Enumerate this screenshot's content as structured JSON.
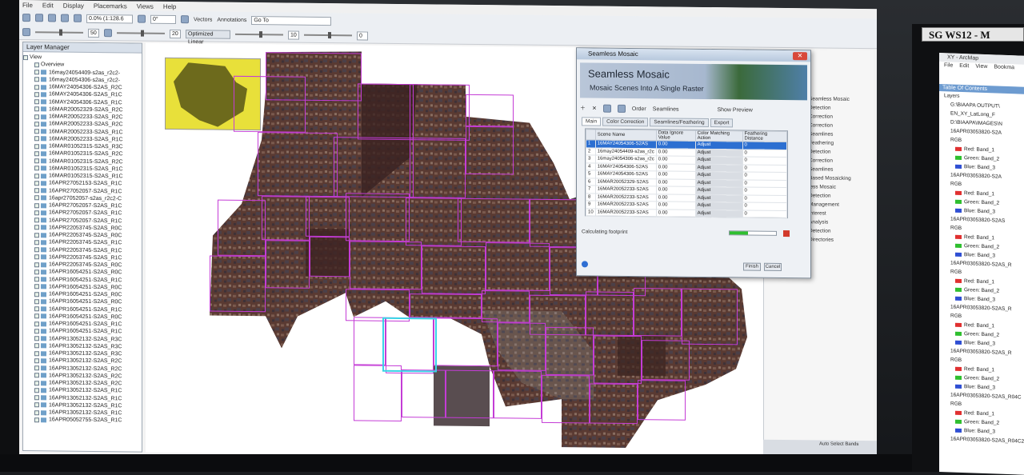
{
  "app": {
    "menus": [
      "File",
      "Edit",
      "Display",
      "Placemarks",
      "Views",
      "Help"
    ],
    "zoom_value": "0.0% (1:128.6",
    "angle_value": "0°",
    "field_50": "50",
    "field_20": "20",
    "field_10": "10",
    "field_0": "0",
    "stretch_label": "Optimized Linear",
    "vectors_label": "Vectors",
    "annotations_label": "Annotations",
    "goto_label": "Go To"
  },
  "layer_manager": {
    "title": "Layer Manager",
    "view_label": "View",
    "overview_label": "Overview",
    "layers": [
      "16may24054409-s2as_r2c2-",
      "16may24054306-s2as_r2c2-",
      "16MAY24054306-S2AS_R2C",
      "16MAY24054306-S2AS_R1C",
      "16MAY24054306-S2AS_R1C",
      "16MAR20052329-S2AS_R2C",
      "16MAR20052233-S2AS_R2C",
      "16MAR20052233-S2AS_R2C",
      "16MAR20052233-S2AS_R1C",
      "16MAR20052233-S2AS_R1C",
      "16MAR01052315-S2AS_R3C",
      "16MAR01052315-S2AS_R2C",
      "16MAR01052315-S2AS_R2C",
      "16MAR01052315-S2AS_R1C",
      "16MAR01052315-S2AS_R1C",
      "16APR27052153-S2AS_R1C",
      "16APR27052057-S2AS_R1C",
      "16apr27052057-s2as_r2c2-C",
      "16APR27052057-S2AS_R1C",
      "16APR27052057-S2AS_R1C",
      "16APR27052057-S2AS_R1C",
      "16APR22053745-S2AS_R0C",
      "16APR22053745-S2AS_R0C",
      "16APR22053745-S2AS_R1C",
      "16APR22053745-S2AS_R1C",
      "16APR22053745-S2AS_R1C",
      "16APR22053745-S2AS_R0C",
      "16APR16054251-S2AS_R0C",
      "16APR16054251-S2AS_R1C",
      "16APR16054251-S2AS_R0C",
      "16APR16054251-S2AS_R0C",
      "16APR16054251-S2AS_R0C",
      "16APR16054251-S2AS_R1C",
      "16APR16054251-S2AS_R0C",
      "16APR16054251-S2AS_R1C",
      "16APR16054251-S2AS_R1C",
      "16APR13052132-S2AS_R3C",
      "16APR13052132-S2AS_R3C",
      "16APR13052132-S2AS_R3C",
      "16APR13052132-S2AS_R2C",
      "16APR13052132-S2AS_R2C",
      "16APR13052132-S2AS_R2C",
      "16APR13052132-S2AS_R2C",
      "16APR13052132-S2AS_R1C",
      "16APR13052132-S2AS_R1C",
      "16APR13052132-S2AS_R1C",
      "16APR13052132-S2AS_R1C",
      "16APR05052755-S2AS_R1C"
    ]
  },
  "dialog": {
    "window_title": "Seamless Mosaic",
    "banner_title": "Seamless Mosaic",
    "banner_subtitle": "Mosaic Scenes Into A Single Raster",
    "order_label": "Order",
    "seamlines_label": "Seamlines",
    "show_preview_label": "Show Preview",
    "tabs": [
      "Main",
      "Color Correction",
      "Seamlines/Feathering",
      "Export"
    ],
    "columns": [
      "",
      "Scene Name",
      "Data Ignore Value",
      "Color Matching Action",
      "Feathering Distance"
    ],
    "rows": [
      {
        "n": "1",
        "name": "16MAY24054306-S2AS",
        "ignore": "0.00",
        "action": "Adjust",
        "feather": "0"
      },
      {
        "n": "2",
        "name": "16may24054409-s2as_r2c",
        "ignore": "0.00",
        "action": "Adjust",
        "feather": "0"
      },
      {
        "n": "3",
        "name": "16may24054306-s2as_r2c",
        "ignore": "0.00",
        "action": "Adjust",
        "feather": "0"
      },
      {
        "n": "4",
        "name": "16MAY24054306-S2AS",
        "ignore": "0.00",
        "action": "Adjust",
        "feather": "0"
      },
      {
        "n": "5",
        "name": "16MAY24054306-S2AS",
        "ignore": "0.00",
        "action": "Adjust",
        "feather": "0"
      },
      {
        "n": "6",
        "name": "16MAR20052329-S2AS",
        "ignore": "0.00",
        "action": "Adjust",
        "feather": "0"
      },
      {
        "n": "7",
        "name": "16MAR20052233-S2AS",
        "ignore": "0.00",
        "action": "Adjust",
        "feather": "0"
      },
      {
        "n": "8",
        "name": "16MAR20052233-S2AS",
        "ignore": "0.00",
        "action": "Adjust",
        "feather": "0"
      },
      {
        "n": "9",
        "name": "16MAR20052233-S2AS",
        "ignore": "0.00",
        "action": "Adjust",
        "feather": "0"
      },
      {
        "n": "10",
        "name": "16MAR20052233-S2AS",
        "ignore": "0.00",
        "action": "Adjust",
        "feather": "0"
      }
    ],
    "status_text": "Calculating footprint",
    "progress_percent": 40,
    "finish_label": "Finish",
    "cancel_label": "Cancel"
  },
  "right_panel": {
    "items": [
      "Seamless Mosaic",
      "Detection",
      "Correction",
      "Correction",
      "Seamlines",
      "Feathering",
      "Detection",
      "Correction",
      "Seamlines",
      "Based Mosaicking",
      "less Mosaic",
      "Detection",
      "Management",
      "Interest",
      "Analysis",
      "Detection",
      "Directories"
    ],
    "status_strip": "Auto Select Bands"
  },
  "monitor2": {
    "label": "SG WS12 - M",
    "window_title": "XY - ArcMap",
    "menus": [
      "File",
      "Edit",
      "View",
      "Bookma"
    ],
    "toc_title": "Table Of Contents",
    "layers_label": "Layers",
    "toc_rows": [
      {
        "text": "G:\\BIAAPA OUTPUT\\",
        "swatch": ""
      },
      {
        "text": "EN_XY_LatLong_F",
        "swatch": ""
      },
      {
        "text": "D:\\BIAAPA\\IMAGES\\N",
        "swatch": ""
      },
      {
        "text": "16APR03053820-S2A",
        "swatch": ""
      },
      {
        "text": "RGB",
        "swatch": ""
      },
      {
        "text": "Red: Band_1",
        "swatch": "#e03030"
      },
      {
        "text": "Green: Band_2",
        "swatch": "#2fbf2f"
      },
      {
        "text": "Blue: Band_3",
        "swatch": "#2f4fd3"
      },
      {
        "text": "16APR03053820-S2A",
        "swatch": ""
      },
      {
        "text": "RGB",
        "swatch": ""
      },
      {
        "text": "Red: Band_1",
        "swatch": "#e03030"
      },
      {
        "text": "Green: Band_2",
        "swatch": "#2fbf2f"
      },
      {
        "text": "Blue: Band_3",
        "swatch": "#2f4fd3"
      },
      {
        "text": "16APR03053820-S2AS",
        "swatch": ""
      },
      {
        "text": "RGB",
        "swatch": ""
      },
      {
        "text": "Red: Band_1",
        "swatch": "#e03030"
      },
      {
        "text": "Green: Band_2",
        "swatch": "#2fbf2f"
      },
      {
        "text": "Blue: Band_3",
        "swatch": "#2f4fd3"
      },
      {
        "text": "16APR03053820-S2AS_R",
        "swatch": ""
      },
      {
        "text": "RGB",
        "swatch": ""
      },
      {
        "text": "Red: Band_1",
        "swatch": "#e03030"
      },
      {
        "text": "Green: Band_2",
        "swatch": "#2fbf2f"
      },
      {
        "text": "Blue: Band_3",
        "swatch": "#2f4fd3"
      },
      {
        "text": "16APR03053820-S2AS_R",
        "swatch": ""
      },
      {
        "text": "RGB",
        "swatch": ""
      },
      {
        "text": "Red: Band_1",
        "swatch": "#e03030"
      },
      {
        "text": "Green: Band_2",
        "swatch": "#2fbf2f"
      },
      {
        "text": "Blue: Band_3",
        "swatch": "#2f4fd3"
      },
      {
        "text": "16APR03053820-S2AS_R",
        "swatch": ""
      },
      {
        "text": "RGB",
        "swatch": ""
      },
      {
        "text": "Red: Band_1",
        "swatch": "#e03030"
      },
      {
        "text": "Green: Band_2",
        "swatch": "#2fbf2f"
      },
      {
        "text": "Blue: Band_3",
        "swatch": "#2f4fd3"
      },
      {
        "text": "16APR03053820-S2AS_R04C",
        "swatch": ""
      },
      {
        "text": "RGB",
        "swatch": ""
      },
      {
        "text": "Red: Band_1",
        "swatch": "#e03030"
      },
      {
        "text": "Green: Band_2",
        "swatch": "#2fbf2f"
      },
      {
        "text": "Blue: Band_3",
        "swatch": "#2f4fd3"
      },
      {
        "text": "16APR03053820-S2AS_R04C2",
        "swatch": ""
      }
    ]
  },
  "colors": {
    "tile_border": "#c43cd6",
    "selected_tile_border": "#3ad3e6",
    "selected_row": "#2c6fd1",
    "progress_fill": "#2fbf2f"
  }
}
